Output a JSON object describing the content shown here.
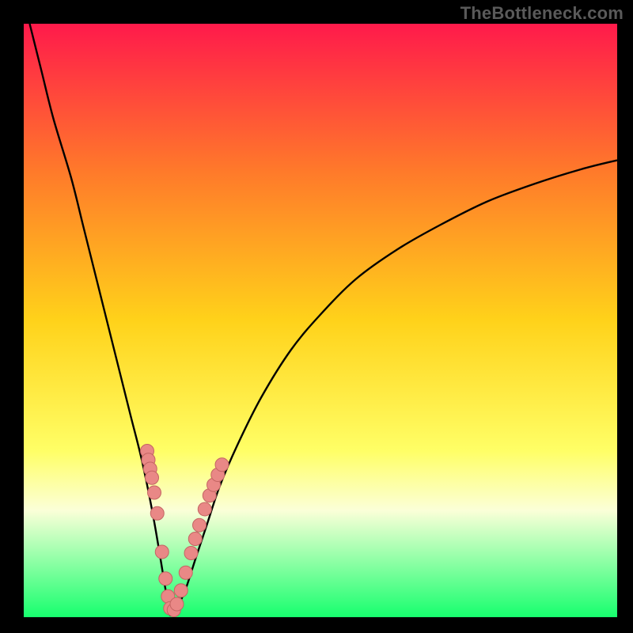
{
  "watermark": "TheBottleneck.com",
  "colors": {
    "frame": "#000000",
    "gradient_top": "#ff1a4b",
    "gradient_mid_upper": "#ff7a2a",
    "gradient_mid": "#ffd21a",
    "gradient_lower": "#ffff66",
    "gradient_band_light": "#fbffd8",
    "gradient_bottom": "#17ff6e",
    "curve": "#000000",
    "dot_fill": "#e98886",
    "dot_stroke": "#c46563"
  },
  "chart_data": {
    "type": "line",
    "title": "",
    "xlabel": "",
    "ylabel": "",
    "xlim": [
      0,
      100
    ],
    "ylim": [
      0,
      100
    ],
    "series": [
      {
        "name": "bottleneck-curve",
        "x": [
          1,
          3,
          5,
          8,
          10,
          12,
          14,
          16,
          18,
          20,
          22,
          24,
          24.5,
          25,
          27,
          29,
          31,
          33,
          36,
          40,
          45,
          50,
          56,
          63,
          70,
          78,
          86,
          94,
          100
        ],
        "y": [
          100,
          92,
          84,
          74,
          66,
          58,
          50,
          42,
          34,
          26,
          16,
          4,
          1,
          0.5,
          4,
          10,
          16,
          22,
          29,
          37,
          45,
          51,
          57,
          62,
          66,
          70,
          73,
          75.5,
          77
        ]
      }
    ],
    "points": [
      {
        "x": 20.8,
        "y": 28
      },
      {
        "x": 21.0,
        "y": 26.5
      },
      {
        "x": 21.3,
        "y": 25
      },
      {
        "x": 21.6,
        "y": 23.5
      },
      {
        "x": 22.0,
        "y": 21
      },
      {
        "x": 22.5,
        "y": 17.5
      },
      {
        "x": 23.3,
        "y": 11
      },
      {
        "x": 23.9,
        "y": 6.5
      },
      {
        "x": 24.3,
        "y": 3.5
      },
      {
        "x": 24.7,
        "y": 1.5
      },
      {
        "x": 25.3,
        "y": 1.2
      },
      {
        "x": 25.8,
        "y": 2.2
      },
      {
        "x": 26.5,
        "y": 4.5
      },
      {
        "x": 27.3,
        "y": 7.5
      },
      {
        "x": 28.2,
        "y": 10.8
      },
      {
        "x": 28.9,
        "y": 13.2
      },
      {
        "x": 29.6,
        "y": 15.5
      },
      {
        "x": 30.5,
        "y": 18.2
      },
      {
        "x": 31.3,
        "y": 20.5
      },
      {
        "x": 32.0,
        "y": 22.3
      },
      {
        "x": 32.7,
        "y": 24.0
      },
      {
        "x": 33.4,
        "y": 25.7
      }
    ],
    "gradient_stops": [
      {
        "pct": 0,
        "value": 100,
        "color": "#ff1a4b"
      },
      {
        "pct": 25,
        "value": 75,
        "color": "#ff7a2a"
      },
      {
        "pct": 50,
        "value": 50,
        "color": "#ffd21a"
      },
      {
        "pct": 72,
        "value": 28,
        "color": "#ffff66"
      },
      {
        "pct": 82,
        "value": 18,
        "color": "#fbffd8"
      },
      {
        "pct": 100,
        "value": 0,
        "color": "#17ff6e"
      }
    ]
  }
}
